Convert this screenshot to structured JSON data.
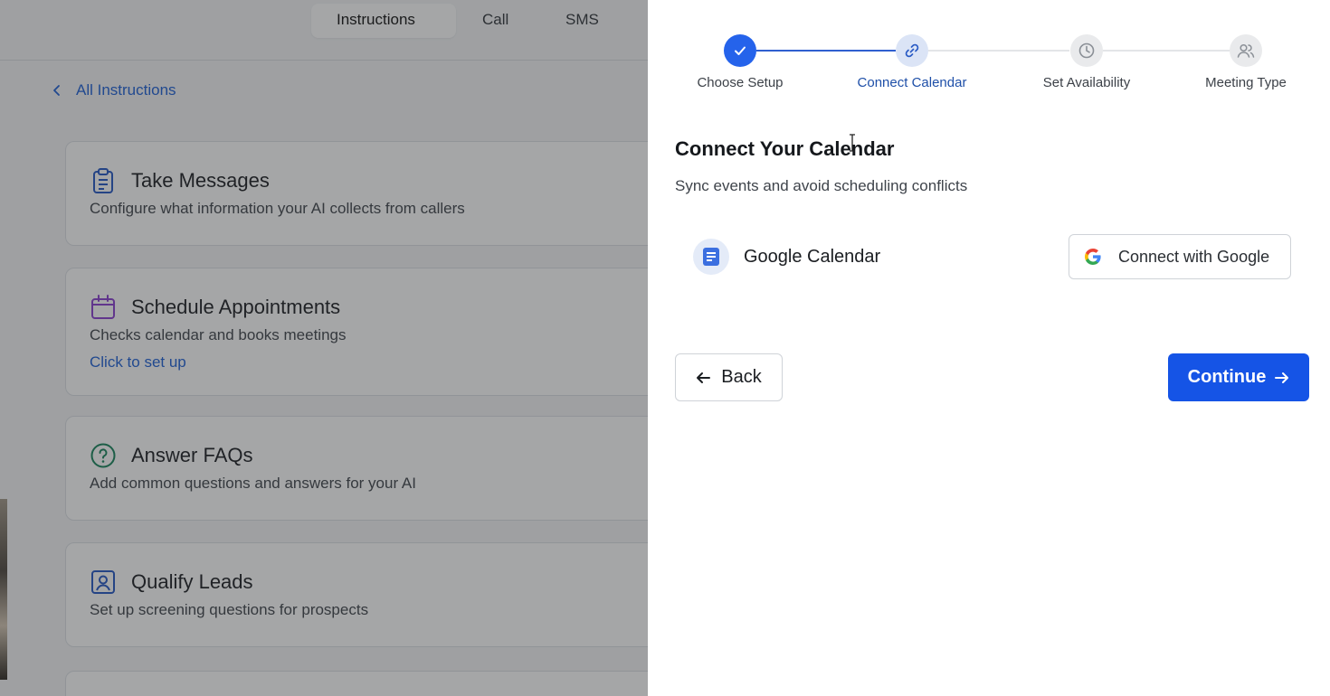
{
  "tabs": [
    "Instructions",
    "Call",
    "SMS"
  ],
  "back_link": "All Instructions",
  "cards": [
    {
      "title": "Take Messages",
      "description": "Configure what information your AI collects from callers",
      "link": ""
    },
    {
      "title": "Schedule Appointments",
      "description": "Checks calendar and books meetings",
      "link": "Click to set up"
    },
    {
      "title": "Answer FAQs",
      "description": "Add common questions and answers for your AI",
      "link": ""
    },
    {
      "title": "Qualify Leads",
      "description": "Set up screening questions for prospects",
      "link": ""
    }
  ],
  "stepper": {
    "steps": [
      {
        "label": "Choose Setup",
        "state": "done",
        "icon": "check-icon"
      },
      {
        "label": "Connect Calendar",
        "state": "current",
        "icon": "link-icon"
      },
      {
        "label": "Set Availability",
        "state": "todo",
        "icon": "clock-icon"
      },
      {
        "label": "Meeting Type",
        "state": "todo",
        "icon": "users-icon"
      }
    ]
  },
  "drawer": {
    "title": "Connect Your Calendar",
    "subtitle": "Sync events and avoid scheduling conflicts",
    "provider_name": "Google Calendar",
    "connect_label": "Connect with Google",
    "back_label": "Back",
    "continue_label": "Continue"
  },
  "colors": {
    "primary": "#1554e6",
    "link": "#1d5fd6",
    "step_current_label": "#1e4fa8"
  }
}
